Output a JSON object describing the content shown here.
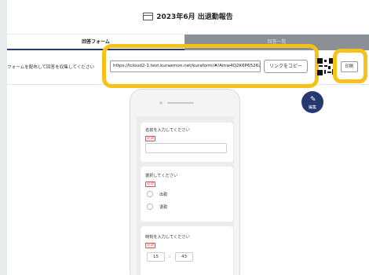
{
  "header": {
    "title": "2023年6月 出退勤報告"
  },
  "tabs": [
    {
      "label": "回答フォーム",
      "active": true
    },
    {
      "label": "回答一覧",
      "active": false
    }
  ],
  "share": {
    "label": "フォームを配布して回答を収集してください",
    "url": "https://lcloud2-1.test.kuraemon.net/kuraform/#/Amw4Q2K6P65262eT/kc",
    "copy_button": "リンクをコピー",
    "print_button": "印刷"
  },
  "edit_button": {
    "label": "編集",
    "icon": "pencil-icon"
  },
  "form": {
    "questions": [
      {
        "label": "名前を入力してください",
        "required_badge": "必須",
        "type": "text",
        "value": ""
      },
      {
        "label": "選択してください",
        "required_badge": "必須",
        "type": "radio",
        "options": [
          "出勤",
          "退勤"
        ]
      },
      {
        "label": "時刻を入力してください",
        "required_badge": "必須",
        "type": "time",
        "hour": "15",
        "separator": ":",
        "minute": "43"
      }
    ]
  },
  "colors": {
    "highlight": "#f5c11a",
    "accent": "#263870",
    "inactive_tab": "#8b9096",
    "required": "#e14b4b"
  }
}
